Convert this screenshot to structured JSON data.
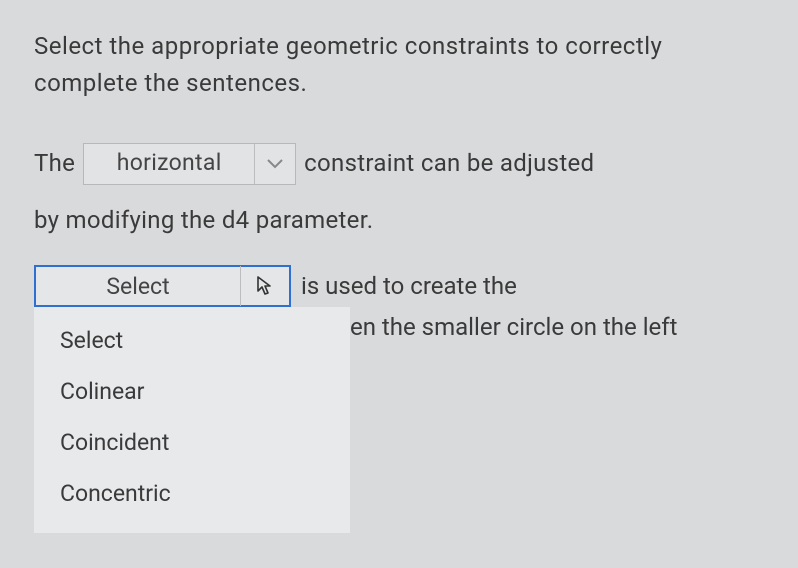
{
  "instruction": "Select the appropriate geometric constraints to correctly complete the sentences.",
  "sentence1": {
    "before": "The",
    "select_value": "horizontal",
    "after1": "constraint can be adjusted",
    "after2": "by modifying the d4 parameter."
  },
  "sentence2": {
    "select_value": "Select",
    "after1": "is used to create the",
    "after2_suffix": "en the smaller circle on the left",
    "options": [
      "Select",
      "Colinear",
      "Coincident",
      "Concentric"
    ]
  }
}
